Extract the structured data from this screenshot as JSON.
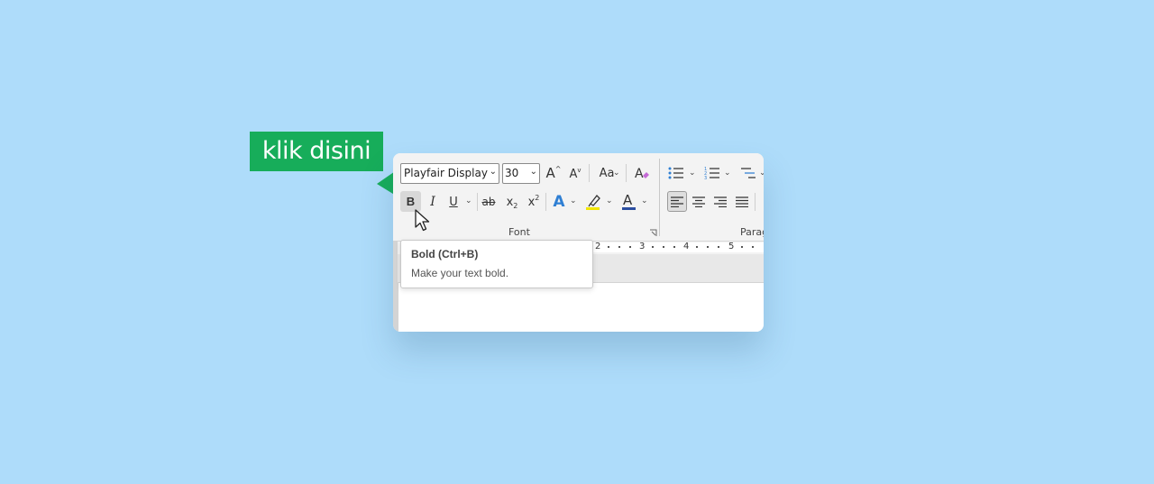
{
  "callout": {
    "label": "klik disini"
  },
  "font_group": {
    "font_name": "Playfair Display",
    "font_size": "30",
    "grow_font_label": "A",
    "shrink_font_label": "A",
    "change_case_label": "Aa",
    "bold_label": "B",
    "italic_label": "I",
    "underline_label": "U",
    "strikethrough_label": "ab",
    "subscript_label": "x",
    "subscript_sub": "2",
    "superscript_label": "x",
    "superscript_sup": "2",
    "text_effects_label": "A",
    "font_color_label": "A",
    "group_label": "Font"
  },
  "paragraph_group": {
    "group_label": "Parag"
  },
  "ruler": {
    "numbers": [
      "2",
      "3",
      "4",
      "5"
    ]
  },
  "tooltip": {
    "title": "Bold (Ctrl+B)",
    "description": "Make your text bold."
  },
  "colors": {
    "background": "#aedcfa",
    "callout": "#17ad5a",
    "highlight": "#f2e600",
    "font_color": "#2b4ea0",
    "text_effects": "#2f7fd3"
  }
}
